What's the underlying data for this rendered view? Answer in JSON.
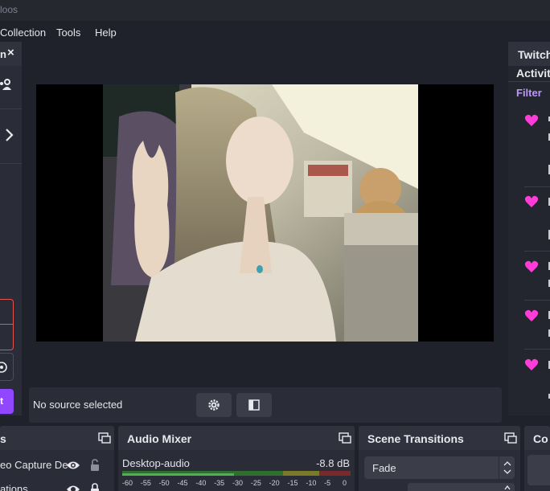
{
  "title_fragment": "loos",
  "menu": [
    {
      "label": "Collection"
    },
    {
      "label": "Tools"
    },
    {
      "label": "Help"
    }
  ],
  "left_dock": {
    "name_fragment": "n",
    "close_glyph": "×",
    "button_fragment": "t"
  },
  "preview": {
    "status": "No source selected"
  },
  "right_dock": {
    "title_fragment": "Twitch",
    "tab_fragment": "Activit",
    "filter": "Filter",
    "heart_color": "#ff3cd8"
  },
  "docks": {
    "sources": {
      "title_fragment": "s",
      "rows": [
        {
          "label": "eo Capture De"
        },
        {
          "label": "ations"
        }
      ]
    },
    "mixer": {
      "title": "Audio Mixer",
      "channel": "Desktop-audio",
      "db": "-8.8 dB",
      "ticks": [
        "-60",
        "-55",
        "-50",
        "-45",
        "-40",
        "-35",
        "-30",
        "-25",
        "-20",
        "-15",
        "-10",
        "-5",
        "0"
      ],
      "level_fraction": 0.49
    },
    "transitions": {
      "title": "Scene Transitions",
      "selected": "Fade"
    },
    "controls": {
      "title_fragment": "Co"
    }
  },
  "colors": {
    "accent": "#9147ff",
    "filter": "#bf94ff",
    "alert": "#e4534d"
  }
}
